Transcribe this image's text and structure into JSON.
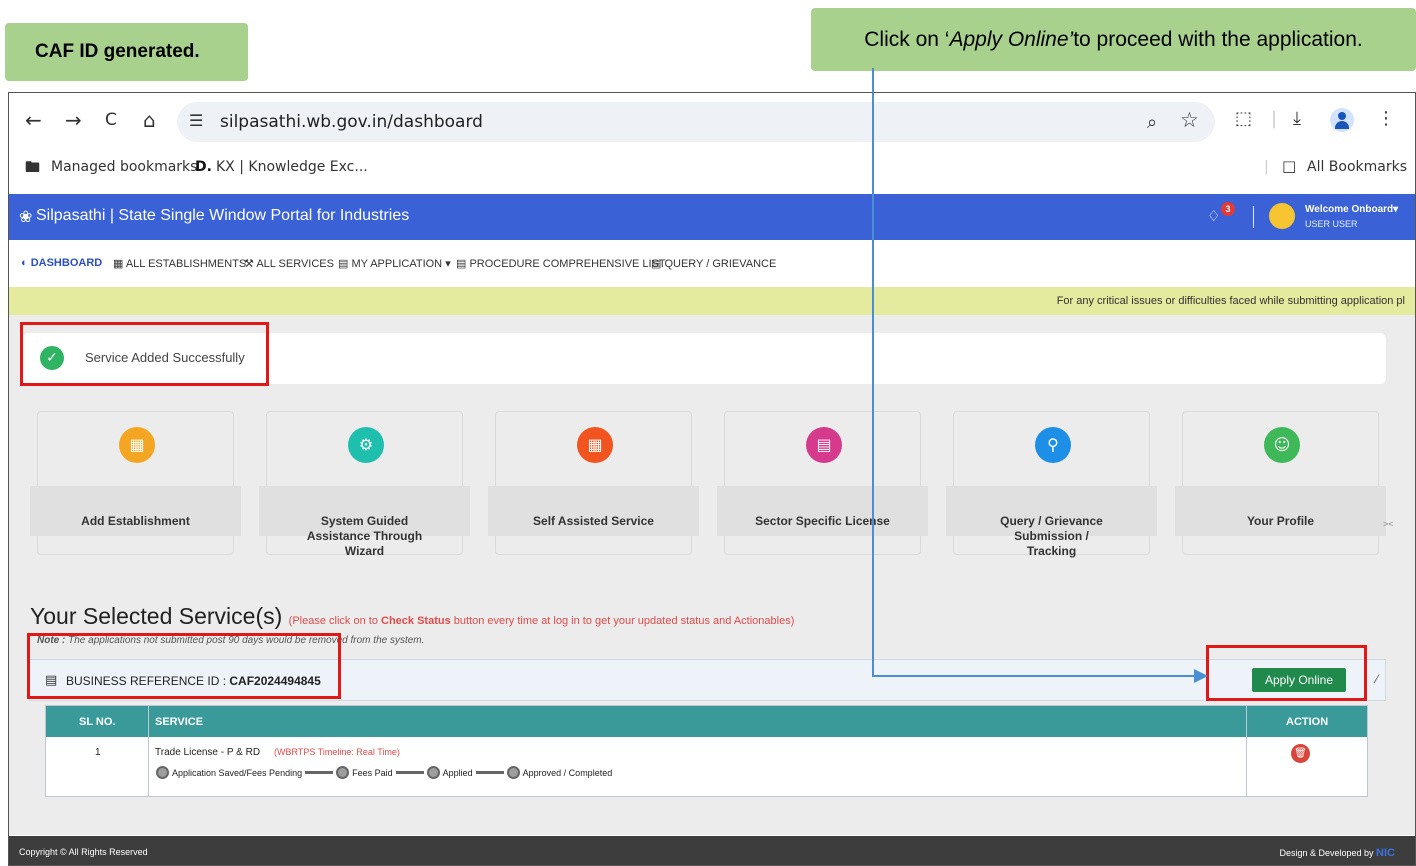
{
  "callouts": {
    "left": "CAF ID generated.",
    "right_pre": "Click on ‘",
    "right_em": "Apply Online’",
    "right_post": " to proceed with the application."
  },
  "browser": {
    "back": "←",
    "forward": "→",
    "reload": "C",
    "home": "⌂",
    "url": "silpasathi.wb.gov.in/dashboard",
    "zoom_icon": "⌕",
    "star_icon": "☆",
    "ext_icon": "⬚",
    "download_icon": "⤓",
    "menu_icon": "⋮",
    "bookmarks": [
      "Managed bookmarks",
      "KX | Knowledge Exc..."
    ],
    "all_bookmarks": "All Bookmarks"
  },
  "app": {
    "title": "Silpasathi | State Single Window Portal for Industries",
    "notifications": "3",
    "welcome": "Welcome Onboard",
    "user": "USER USER",
    "menu": [
      "DASHBOARD",
      "ALL ESTABLISHMENTS",
      "ALL SERVICES",
      "MY APPLICATION",
      "PROCEDURE COMPREHENSIVE LIST",
      "QUERY / GRIEVANCE"
    ],
    "notice": "For any critical issues or difficulties faced while submitting application pl"
  },
  "success": {
    "message": "Service Added Successfully"
  },
  "tiles": [
    {
      "label": "Add Establishment",
      "color": "#f4a623"
    },
    {
      "label": "System Guided Assistance Through Wizard",
      "color": "#1fbfae"
    },
    {
      "label": "Self Assisted Service",
      "color": "#f2541f"
    },
    {
      "label": "Sector Specific License",
      "color": "#d63a8c"
    },
    {
      "label": "Query / Grievance Submission / Tracking",
      "color": "#1e8fe6"
    },
    {
      "label": "Your Profile",
      "color": "#3fb85a"
    }
  ],
  "selected": {
    "title": "Your Selected Service(s)",
    "note_pre": "(Please click on to ",
    "note_bold": "Check Status",
    "note_post": " button every time at log in to get your updated status and Actionables)",
    "note_label": "Note :",
    "note_text": "The applications not submitted post 90 days would be removed from the system.",
    "brid_label": "BUSINESS REFERENCE ID :",
    "brid_value": "CAF2024494845",
    "apply_button": "Apply Online"
  },
  "table": {
    "headers": [
      "SL NO.",
      "SERVICE",
      "ACTION"
    ],
    "rows": [
      {
        "sl": "1",
        "service": "Trade License - P & RD",
        "timeline_note": "(WBRTPS Timeline: Real Time)",
        "steps": [
          "Application Saved/Fees Pending",
          "Fees Paid",
          "Applied",
          "Approved / Completed"
        ]
      }
    ]
  },
  "footer": {
    "left": "Copyright © All Rights Reserved",
    "right": "Design & Developed by",
    "nic": "NIC"
  },
  "colors": {
    "header_blue": "#3a62d6",
    "callout_green": "#a9d18e",
    "table_teal": "#3a9a9a",
    "apply_green": "#1f8a4c",
    "highlight_red": "#e11818"
  }
}
